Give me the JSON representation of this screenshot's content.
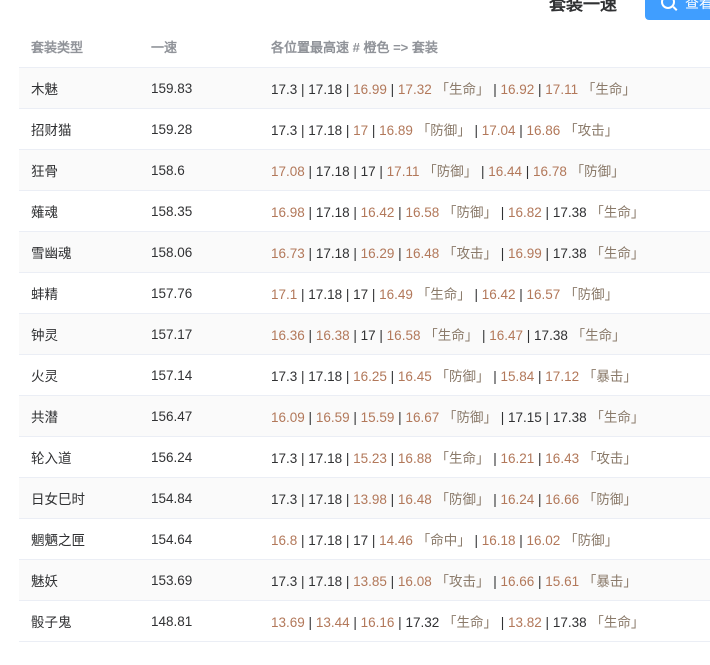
{
  "header": {
    "title": "套装一速",
    "view_button_label": "查看"
  },
  "colors": {
    "orange": "#b2785a",
    "black": "#303133",
    "header_text": "#909399",
    "button_bg": "#409eff",
    "stripe": "#fafafa"
  },
  "table": {
    "columns": [
      "套装类型",
      "一速",
      "各位置最高速 # 橙色 => 套装"
    ],
    "rows": [
      {
        "name": "木魅",
        "speed": "159.83",
        "segments": [
          {
            "t": "17.3 ",
            "c": "black"
          },
          {
            "t": "| ",
            "c": "black"
          },
          {
            "t": "17.18 ",
            "c": "black"
          },
          {
            "t": "| ",
            "c": "black"
          },
          {
            "t": "16.99 ",
            "c": "orange"
          },
          {
            "t": "| ",
            "c": "black"
          },
          {
            "t": "17.32 ",
            "c": "orange"
          },
          {
            "t": "「生命」",
            "c": "bracket"
          },
          {
            "t": " | ",
            "c": "black"
          },
          {
            "t": "16.92 ",
            "c": "orange"
          },
          {
            "t": "| ",
            "c": "black"
          },
          {
            "t": "17.11 ",
            "c": "orange"
          },
          {
            "t": "「生命」",
            "c": "bracket"
          }
        ]
      },
      {
        "name": "招财猫",
        "speed": "159.28",
        "segments": [
          {
            "t": "17.3 ",
            "c": "black"
          },
          {
            "t": "| ",
            "c": "black"
          },
          {
            "t": "17.18 ",
            "c": "black"
          },
          {
            "t": "| ",
            "c": "black"
          },
          {
            "t": "17 ",
            "c": "orange"
          },
          {
            "t": "| ",
            "c": "black"
          },
          {
            "t": "16.89 ",
            "c": "orange"
          },
          {
            "t": "「防御」",
            "c": "bracket"
          },
          {
            "t": " | ",
            "c": "black"
          },
          {
            "t": "17.04 ",
            "c": "orange"
          },
          {
            "t": "| ",
            "c": "black"
          },
          {
            "t": "16.86 ",
            "c": "orange"
          },
          {
            "t": "「攻击」",
            "c": "bracket"
          }
        ]
      },
      {
        "name": "狂骨",
        "speed": "158.6",
        "segments": [
          {
            "t": "17.08 ",
            "c": "orange"
          },
          {
            "t": "| ",
            "c": "black"
          },
          {
            "t": "17.18 ",
            "c": "black"
          },
          {
            "t": "| ",
            "c": "black"
          },
          {
            "t": "17 ",
            "c": "black"
          },
          {
            "t": "| ",
            "c": "black"
          },
          {
            "t": "17.11 ",
            "c": "orange"
          },
          {
            "t": "「防御」",
            "c": "bracket"
          },
          {
            "t": " | ",
            "c": "black"
          },
          {
            "t": "16.44 ",
            "c": "orange"
          },
          {
            "t": "| ",
            "c": "black"
          },
          {
            "t": "16.78 ",
            "c": "orange"
          },
          {
            "t": "「防御」",
            "c": "bracket"
          }
        ]
      },
      {
        "name": "薙魂",
        "speed": "158.35",
        "segments": [
          {
            "t": "16.98 ",
            "c": "orange"
          },
          {
            "t": "| ",
            "c": "black"
          },
          {
            "t": "17.18 ",
            "c": "black"
          },
          {
            "t": "| ",
            "c": "black"
          },
          {
            "t": "16.42 ",
            "c": "orange"
          },
          {
            "t": "| ",
            "c": "black"
          },
          {
            "t": "16.58 ",
            "c": "orange"
          },
          {
            "t": "「防御」",
            "c": "bracket"
          },
          {
            "t": " | ",
            "c": "black"
          },
          {
            "t": "16.82 ",
            "c": "orange"
          },
          {
            "t": "| ",
            "c": "black"
          },
          {
            "t": "17.38 ",
            "c": "black"
          },
          {
            "t": "「生命」",
            "c": "bracket"
          }
        ]
      },
      {
        "name": "雪幽魂",
        "speed": "158.06",
        "segments": [
          {
            "t": "16.73 ",
            "c": "orange"
          },
          {
            "t": "| ",
            "c": "black"
          },
          {
            "t": "17.18 ",
            "c": "black"
          },
          {
            "t": "| ",
            "c": "black"
          },
          {
            "t": "16.29 ",
            "c": "orange"
          },
          {
            "t": "| ",
            "c": "black"
          },
          {
            "t": "16.48 ",
            "c": "orange"
          },
          {
            "t": "「攻击」",
            "c": "bracket"
          },
          {
            "t": " | ",
            "c": "black"
          },
          {
            "t": "16.99 ",
            "c": "orange"
          },
          {
            "t": "| ",
            "c": "black"
          },
          {
            "t": "17.38 ",
            "c": "black"
          },
          {
            "t": "「生命」",
            "c": "bracket"
          }
        ]
      },
      {
        "name": "蚌精",
        "speed": "157.76",
        "segments": [
          {
            "t": "17.1 ",
            "c": "orange"
          },
          {
            "t": "| ",
            "c": "black"
          },
          {
            "t": "17.18 ",
            "c": "black"
          },
          {
            "t": "| ",
            "c": "black"
          },
          {
            "t": "17 ",
            "c": "black"
          },
          {
            "t": "| ",
            "c": "black"
          },
          {
            "t": "16.49 ",
            "c": "orange"
          },
          {
            "t": "「生命」",
            "c": "bracket"
          },
          {
            "t": " | ",
            "c": "black"
          },
          {
            "t": "16.42 ",
            "c": "orange"
          },
          {
            "t": "| ",
            "c": "black"
          },
          {
            "t": "16.57 ",
            "c": "orange"
          },
          {
            "t": "「防御」",
            "c": "bracket"
          }
        ]
      },
      {
        "name": "钟灵",
        "speed": "157.17",
        "segments": [
          {
            "t": "16.36 ",
            "c": "orange"
          },
          {
            "t": "| ",
            "c": "black"
          },
          {
            "t": "16.38 ",
            "c": "orange"
          },
          {
            "t": "| ",
            "c": "black"
          },
          {
            "t": "17 ",
            "c": "black"
          },
          {
            "t": "| ",
            "c": "black"
          },
          {
            "t": "16.58 ",
            "c": "orange"
          },
          {
            "t": "「生命」",
            "c": "bracket"
          },
          {
            "t": " | ",
            "c": "black"
          },
          {
            "t": "16.47 ",
            "c": "orange"
          },
          {
            "t": "| ",
            "c": "black"
          },
          {
            "t": "17.38 ",
            "c": "black"
          },
          {
            "t": "「生命」",
            "c": "bracket"
          }
        ]
      },
      {
        "name": "火灵",
        "speed": "157.14",
        "segments": [
          {
            "t": "17.3 ",
            "c": "black"
          },
          {
            "t": "| ",
            "c": "black"
          },
          {
            "t": "17.18 ",
            "c": "black"
          },
          {
            "t": "| ",
            "c": "black"
          },
          {
            "t": "16.25 ",
            "c": "orange"
          },
          {
            "t": "| ",
            "c": "black"
          },
          {
            "t": "16.45 ",
            "c": "orange"
          },
          {
            "t": "「防御」",
            "c": "bracket"
          },
          {
            "t": " | ",
            "c": "black"
          },
          {
            "t": "15.84 ",
            "c": "orange"
          },
          {
            "t": "| ",
            "c": "black"
          },
          {
            "t": "17.12 ",
            "c": "orange"
          },
          {
            "t": "「暴击」",
            "c": "bracket"
          }
        ]
      },
      {
        "name": "共潜",
        "speed": "156.47",
        "segments": [
          {
            "t": "16.09 ",
            "c": "orange"
          },
          {
            "t": "| ",
            "c": "black"
          },
          {
            "t": "16.59 ",
            "c": "orange"
          },
          {
            "t": "| ",
            "c": "black"
          },
          {
            "t": "15.59 ",
            "c": "orange"
          },
          {
            "t": "| ",
            "c": "black"
          },
          {
            "t": "16.67 ",
            "c": "orange"
          },
          {
            "t": "「防御」",
            "c": "bracket"
          },
          {
            "t": " | ",
            "c": "black"
          },
          {
            "t": "17.15 ",
            "c": "black"
          },
          {
            "t": "| ",
            "c": "black"
          },
          {
            "t": "17.38 ",
            "c": "black"
          },
          {
            "t": "「生命」",
            "c": "bracket"
          }
        ]
      },
      {
        "name": "轮入道",
        "speed": "156.24",
        "segments": [
          {
            "t": "17.3 ",
            "c": "black"
          },
          {
            "t": "| ",
            "c": "black"
          },
          {
            "t": "17.18 ",
            "c": "black"
          },
          {
            "t": "| ",
            "c": "black"
          },
          {
            "t": "15.23 ",
            "c": "orange"
          },
          {
            "t": "| ",
            "c": "black"
          },
          {
            "t": "16.88 ",
            "c": "orange"
          },
          {
            "t": "「生命」",
            "c": "bracket"
          },
          {
            "t": " | ",
            "c": "black"
          },
          {
            "t": "16.21 ",
            "c": "orange"
          },
          {
            "t": "| ",
            "c": "black"
          },
          {
            "t": "16.43 ",
            "c": "orange"
          },
          {
            "t": "「攻击」",
            "c": "bracket"
          }
        ]
      },
      {
        "name": "日女巳时",
        "speed": "154.84",
        "segments": [
          {
            "t": "17.3 ",
            "c": "black"
          },
          {
            "t": "| ",
            "c": "black"
          },
          {
            "t": "17.18 ",
            "c": "black"
          },
          {
            "t": "| ",
            "c": "black"
          },
          {
            "t": "13.98 ",
            "c": "orange"
          },
          {
            "t": "| ",
            "c": "black"
          },
          {
            "t": "16.48 ",
            "c": "orange"
          },
          {
            "t": "「防御」",
            "c": "bracket"
          },
          {
            "t": " | ",
            "c": "black"
          },
          {
            "t": "16.24 ",
            "c": "orange"
          },
          {
            "t": "| ",
            "c": "black"
          },
          {
            "t": "16.66 ",
            "c": "orange"
          },
          {
            "t": "「防御」",
            "c": "bracket"
          }
        ]
      },
      {
        "name": "魍魉之匣",
        "speed": "154.64",
        "segments": [
          {
            "t": "16.8 ",
            "c": "orange"
          },
          {
            "t": "| ",
            "c": "black"
          },
          {
            "t": "17.18 ",
            "c": "black"
          },
          {
            "t": "| ",
            "c": "black"
          },
          {
            "t": "17 ",
            "c": "black"
          },
          {
            "t": "| ",
            "c": "black"
          },
          {
            "t": "14.46 ",
            "c": "orange"
          },
          {
            "t": "「命中」",
            "c": "bracket"
          },
          {
            "t": " | ",
            "c": "black"
          },
          {
            "t": "16.18 ",
            "c": "orange"
          },
          {
            "t": "| ",
            "c": "black"
          },
          {
            "t": "16.02 ",
            "c": "orange"
          },
          {
            "t": "「防御」",
            "c": "bracket"
          }
        ]
      },
      {
        "name": "魅妖",
        "speed": "153.69",
        "segments": [
          {
            "t": "17.3 ",
            "c": "black"
          },
          {
            "t": "| ",
            "c": "black"
          },
          {
            "t": "17.18 ",
            "c": "black"
          },
          {
            "t": "| ",
            "c": "black"
          },
          {
            "t": "13.85 ",
            "c": "orange"
          },
          {
            "t": "| ",
            "c": "black"
          },
          {
            "t": "16.08 ",
            "c": "orange"
          },
          {
            "t": "「攻击」",
            "c": "bracket"
          },
          {
            "t": " | ",
            "c": "black"
          },
          {
            "t": "16.66 ",
            "c": "orange"
          },
          {
            "t": "| ",
            "c": "black"
          },
          {
            "t": "15.61 ",
            "c": "orange"
          },
          {
            "t": "「暴击」",
            "c": "bracket"
          }
        ]
      },
      {
        "name": "骰子鬼",
        "speed": "148.81",
        "segments": [
          {
            "t": "13.69 ",
            "c": "orange"
          },
          {
            "t": "| ",
            "c": "black"
          },
          {
            "t": "13.44 ",
            "c": "orange"
          },
          {
            "t": "| ",
            "c": "black"
          },
          {
            "t": "16.16 ",
            "c": "orange"
          },
          {
            "t": "| ",
            "c": "black"
          },
          {
            "t": "17.32 ",
            "c": "black"
          },
          {
            "t": "「生命」",
            "c": "bracket"
          },
          {
            "t": " | ",
            "c": "black"
          },
          {
            "t": "13.82 ",
            "c": "orange"
          },
          {
            "t": "| ",
            "c": "black"
          },
          {
            "t": "17.38 ",
            "c": "black"
          },
          {
            "t": "「生命」",
            "c": "bracket"
          }
        ]
      }
    ]
  }
}
